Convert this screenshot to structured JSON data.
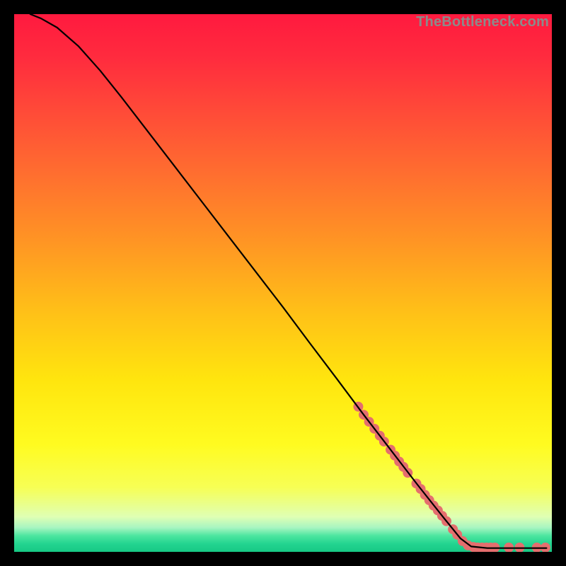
{
  "watermark": "TheBottleneck.com",
  "chart_data": {
    "type": "line",
    "title": "",
    "xlabel": "",
    "ylabel": "",
    "xlim": [
      0,
      100
    ],
    "ylim": [
      0,
      100
    ],
    "grid": false,
    "legend": false,
    "background_gradient_stops": [
      {
        "offset": 0.0,
        "color": "#ff1a3f"
      },
      {
        "offset": 0.08,
        "color": "#ff2b3e"
      },
      {
        "offset": 0.18,
        "color": "#ff4a38"
      },
      {
        "offset": 0.3,
        "color": "#ff6f2f"
      },
      {
        "offset": 0.42,
        "color": "#ff9424"
      },
      {
        "offset": 0.55,
        "color": "#ffbf18"
      },
      {
        "offset": 0.68,
        "color": "#ffe50e"
      },
      {
        "offset": 0.8,
        "color": "#fffb20"
      },
      {
        "offset": 0.88,
        "color": "#f7ff55"
      },
      {
        "offset": 0.935,
        "color": "#dfffb4"
      },
      {
        "offset": 0.955,
        "color": "#a7f5c1"
      },
      {
        "offset": 0.97,
        "color": "#4de6a0"
      },
      {
        "offset": 0.985,
        "color": "#23d490"
      },
      {
        "offset": 1.0,
        "color": "#17c985"
      }
    ],
    "curve": {
      "description": "Bottleneck curve: high in upper-left, descending roughly linearly, flattening near x≈85 to y≈0 and continuing flat to the right edge.",
      "points": [
        {
          "x": 3.0,
          "y": 100.0
        },
        {
          "x": 5.0,
          "y": 99.2
        },
        {
          "x": 8.0,
          "y": 97.5
        },
        {
          "x": 12.0,
          "y": 94.0
        },
        {
          "x": 16.0,
          "y": 89.5
        },
        {
          "x": 20.0,
          "y": 84.5
        },
        {
          "x": 25.0,
          "y": 78.0
        },
        {
          "x": 30.0,
          "y": 71.5
        },
        {
          "x": 35.0,
          "y": 65.0
        },
        {
          "x": 40.0,
          "y": 58.5
        },
        {
          "x": 45.0,
          "y": 52.0
        },
        {
          "x": 50.0,
          "y": 45.5
        },
        {
          "x": 55.0,
          "y": 38.8
        },
        {
          "x": 60.0,
          "y": 32.2
        },
        {
          "x": 65.0,
          "y": 25.5
        },
        {
          "x": 70.0,
          "y": 19.0
        },
        {
          "x": 75.0,
          "y": 12.5
        },
        {
          "x": 80.0,
          "y": 6.2
        },
        {
          "x": 83.0,
          "y": 2.5
        },
        {
          "x": 85.0,
          "y": 1.0
        },
        {
          "x": 88.0,
          "y": 0.7
        },
        {
          "x": 92.0,
          "y": 0.7
        },
        {
          "x": 96.0,
          "y": 0.7
        },
        {
          "x": 99.0,
          "y": 0.7
        }
      ]
    },
    "markers": {
      "description": "Salmon-colored dense dot clusters along the lower-right part of the curve and along the flat bottom.",
      "color": "#e46e6e",
      "radius": 7,
      "points": [
        {
          "x": 64.0,
          "y": 27.0
        },
        {
          "x": 65.0,
          "y": 25.5
        },
        {
          "x": 66.0,
          "y": 24.2
        },
        {
          "x": 67.0,
          "y": 22.9
        },
        {
          "x": 68.0,
          "y": 21.6
        },
        {
          "x": 68.8,
          "y": 20.5
        },
        {
          "x": 70.0,
          "y": 19.0
        },
        {
          "x": 70.8,
          "y": 17.9
        },
        {
          "x": 71.6,
          "y": 16.8
        },
        {
          "x": 72.4,
          "y": 15.8
        },
        {
          "x": 73.2,
          "y": 14.7
        },
        {
          "x": 74.8,
          "y": 12.7
        },
        {
          "x": 75.6,
          "y": 11.7
        },
        {
          "x": 76.4,
          "y": 10.6
        },
        {
          "x": 77.2,
          "y": 9.6
        },
        {
          "x": 78.0,
          "y": 8.6
        },
        {
          "x": 78.8,
          "y": 7.7
        },
        {
          "x": 79.6,
          "y": 6.7
        },
        {
          "x": 80.4,
          "y": 5.7
        },
        {
          "x": 81.6,
          "y": 4.2
        },
        {
          "x": 82.4,
          "y": 3.2
        },
        {
          "x": 83.4,
          "y": 2.0
        },
        {
          "x": 84.4,
          "y": 1.2
        },
        {
          "x": 85.4,
          "y": 0.9
        },
        {
          "x": 86.2,
          "y": 0.8
        },
        {
          "x": 87.0,
          "y": 0.8
        },
        {
          "x": 87.8,
          "y": 0.8
        },
        {
          "x": 88.6,
          "y": 0.8
        },
        {
          "x": 89.4,
          "y": 0.8
        },
        {
          "x": 92.0,
          "y": 0.8
        },
        {
          "x": 94.0,
          "y": 0.8
        },
        {
          "x": 97.2,
          "y": 0.8
        },
        {
          "x": 98.8,
          "y": 0.8
        }
      ]
    }
  }
}
